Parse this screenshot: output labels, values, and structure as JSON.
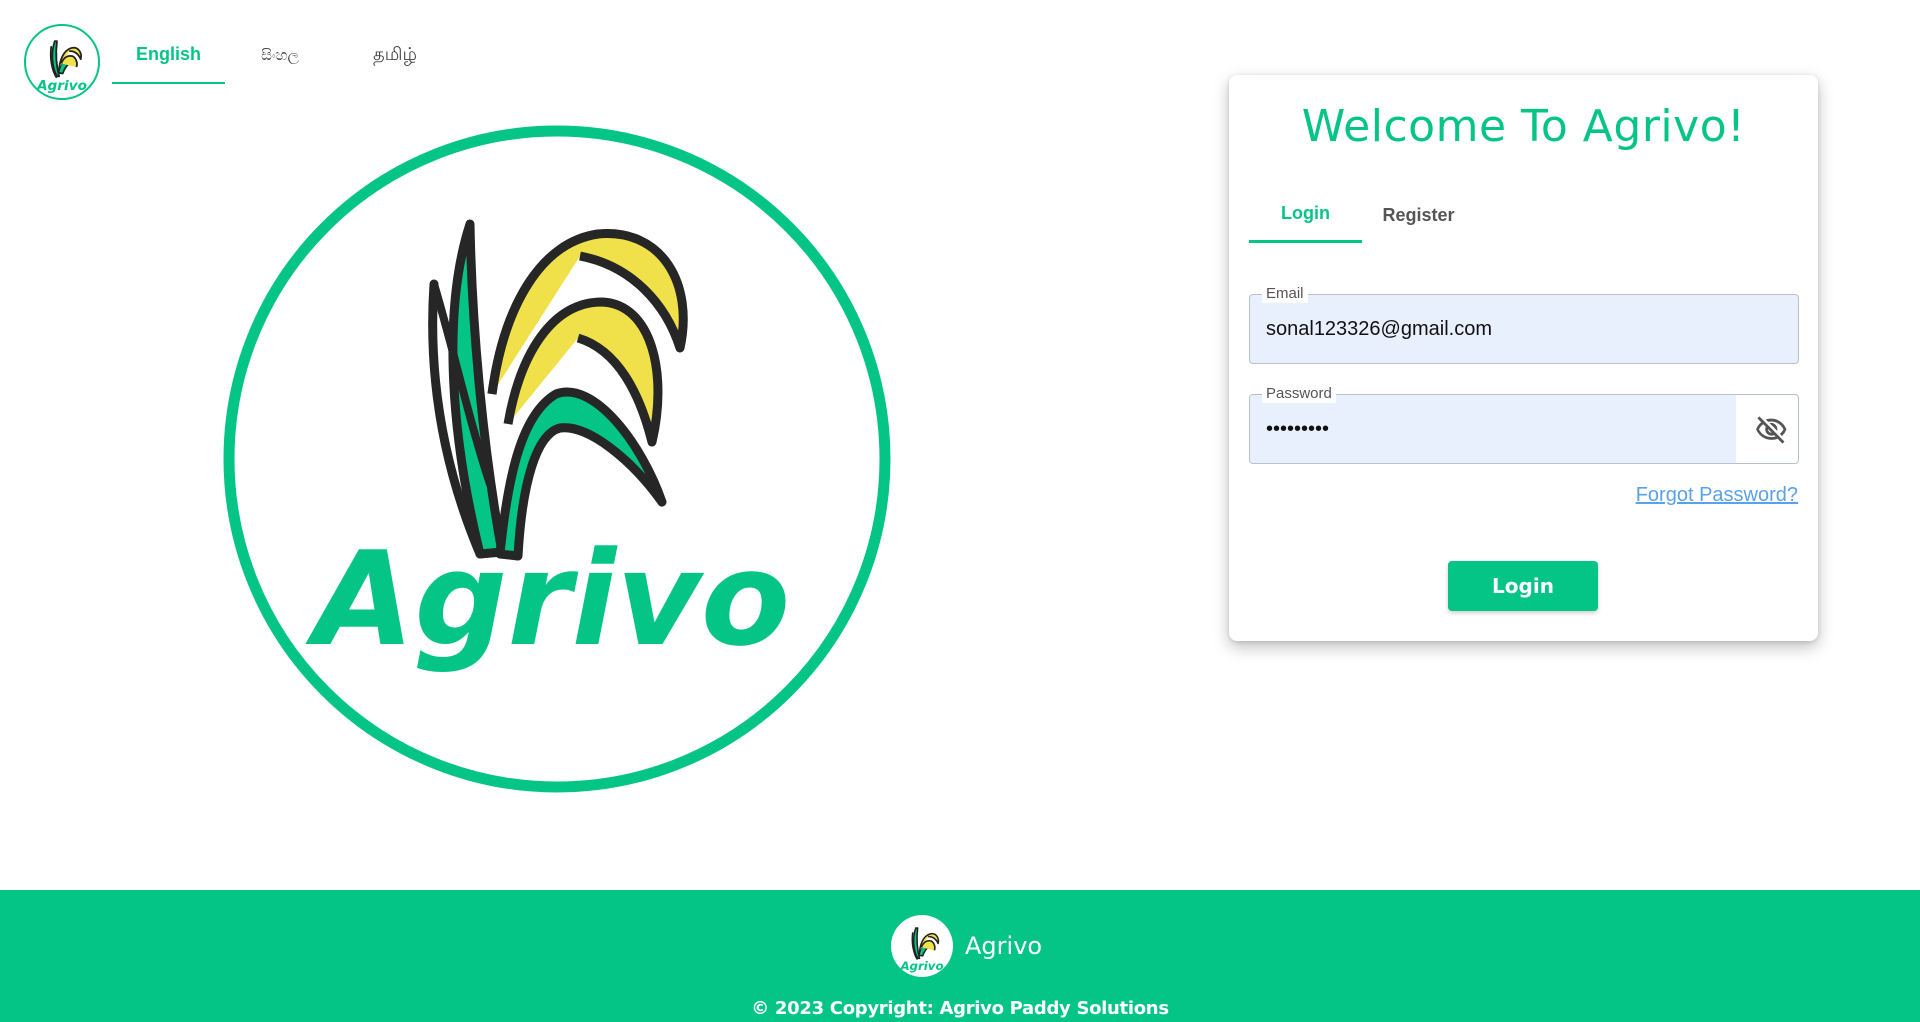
{
  "brand": {
    "name": "Agrivo",
    "accent_color": "#05c586",
    "leaf_yellow": "#f0e14a",
    "logo_text": "Agrivo"
  },
  "language_tabs": [
    {
      "label": "English",
      "active": true
    },
    {
      "label": "සිංහල",
      "active": false
    },
    {
      "label": "தமிழ்",
      "active": false
    }
  ],
  "card": {
    "title": "Welcome To Agrivo!",
    "tabs": [
      {
        "label": "Login",
        "active": true
      },
      {
        "label": "Register",
        "active": false
      }
    ],
    "email": {
      "label": "Email",
      "value": "sonal123326@gmail.com"
    },
    "password": {
      "label": "Password",
      "value": "•••••••••",
      "toggle_icon": "eye-off-icon"
    },
    "forgot_label": "Forgot Password?",
    "login_button": "Login"
  },
  "footer": {
    "brand": "Agrivo",
    "copyright": "© 2023 Copyright: Agrivo Paddy Solutions"
  }
}
